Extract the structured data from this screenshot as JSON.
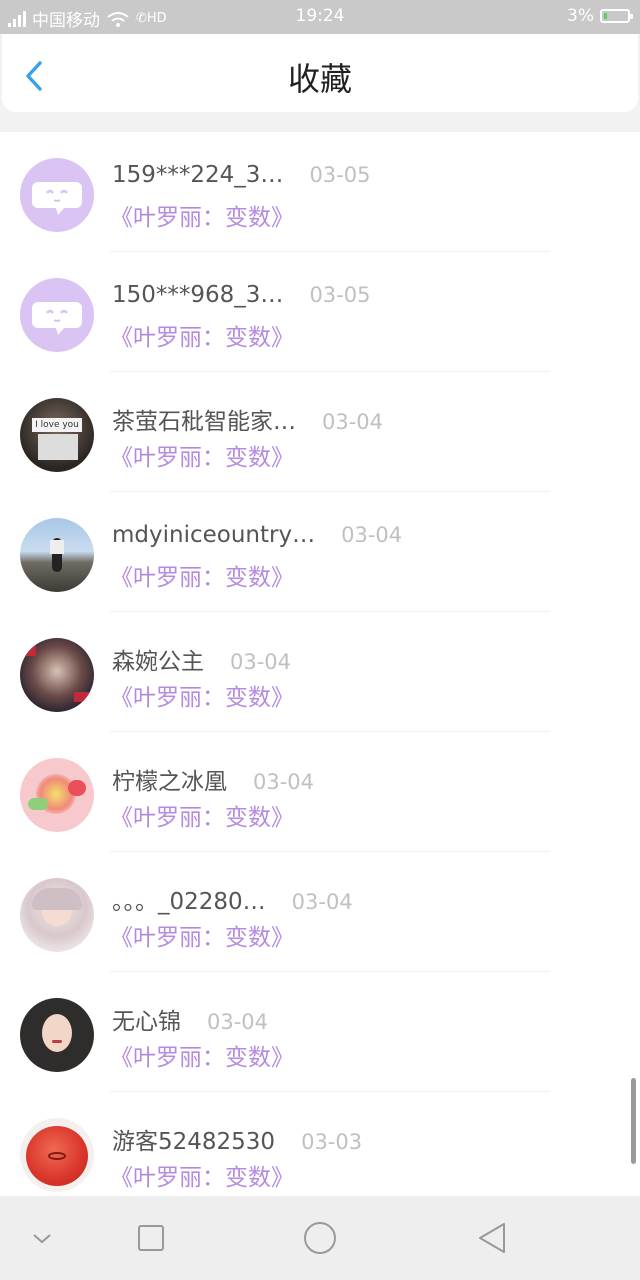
{
  "status": {
    "carrier": "中国移动",
    "network": "4G",
    "hd": "HD",
    "time": "19:24",
    "battery": "3%"
  },
  "header": {
    "title": "收藏",
    "back_icon": "chevron-left-icon"
  },
  "items": [
    {
      "name": "159***224_3…",
      "date": "03-05",
      "book": "《叶罗丽：变数》",
      "avatar": "default-chat-avatar"
    },
    {
      "name": "150***968_3…",
      "date": "03-05",
      "book": "《叶罗丽：变数》",
      "avatar": "default-chat-avatar"
    },
    {
      "name": "茶萤石秕智能家…",
      "date": "03-04",
      "book": "《叶罗丽：变数》",
      "avatar": "photo-avatar",
      "avatar_text": "I love you"
    },
    {
      "name": "mdyiniceountry…",
      "date": "03-04",
      "book": "《叶罗丽：变数》",
      "avatar": "photo-avatar"
    },
    {
      "name": "森婉公主",
      "date": "03-04",
      "book": "《叶罗丽：变数》",
      "avatar": "photo-avatar"
    },
    {
      "name": "柠檬之冰凰",
      "date": "03-04",
      "book": "《叶罗丽：变数》",
      "avatar": "photo-avatar"
    },
    {
      "name": "。。。_02280…",
      "date": "03-04",
      "book": "《叶罗丽：变数》",
      "avatar": "photo-avatar"
    },
    {
      "name": "无心锦",
      "date": "03-04",
      "book": "《叶罗丽：变数》",
      "avatar": "photo-avatar"
    },
    {
      "name": "游客52482530",
      "date": "03-03",
      "book": "《叶罗丽：变数》",
      "avatar": "photo-avatar"
    }
  ],
  "colors": {
    "accent": "#b48be0",
    "back": "#3aa3e8",
    "default_avatar": "#d9c4f3"
  },
  "nav": [
    "collapse-icon",
    "recents-icon",
    "home-icon",
    "back-icon"
  ]
}
